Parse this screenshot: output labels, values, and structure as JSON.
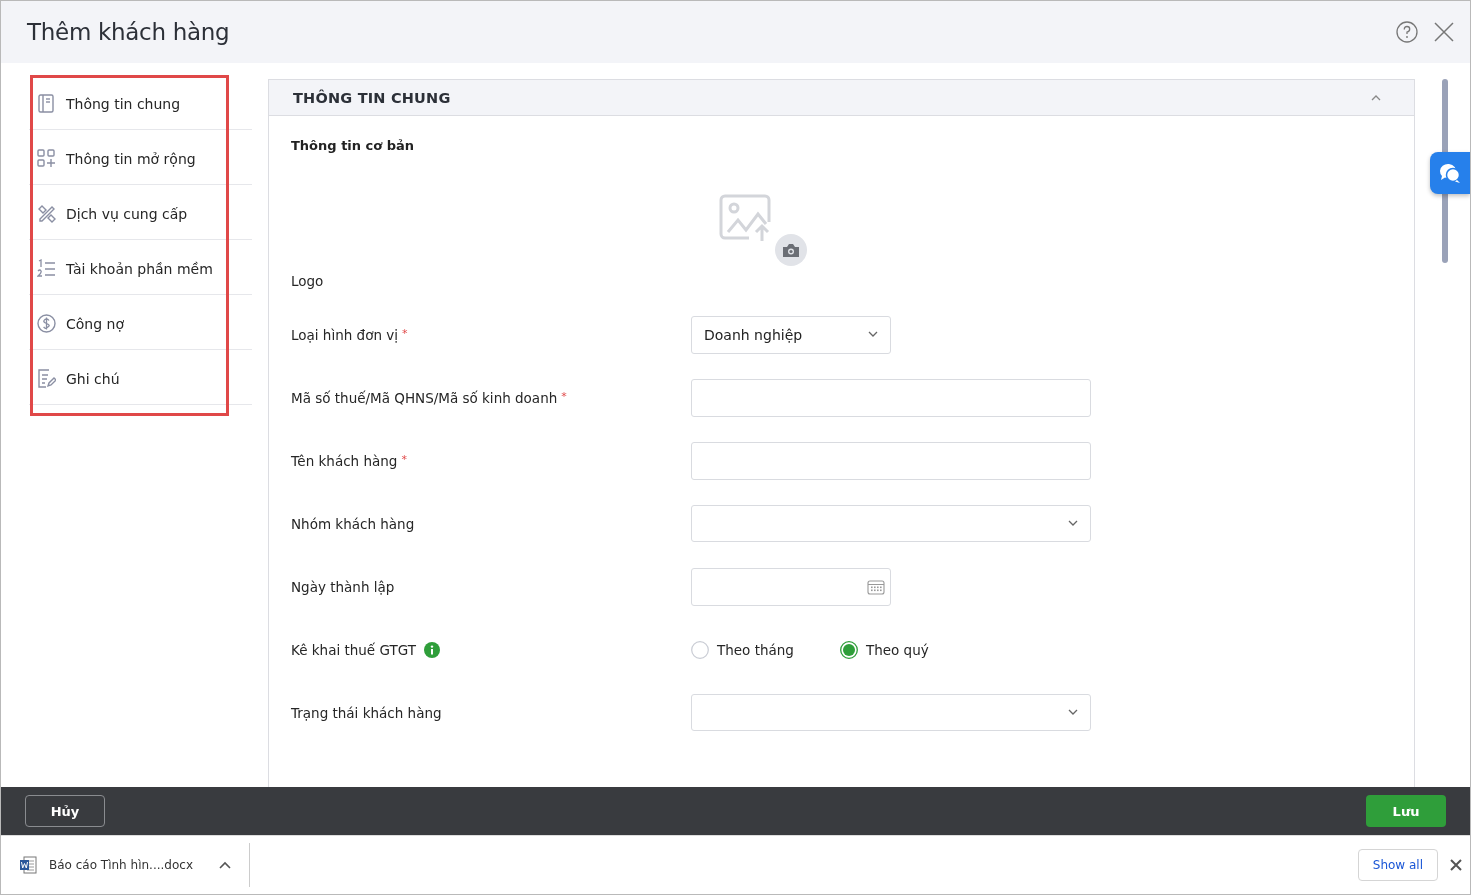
{
  "dialog": {
    "title": "Thêm khách hàng"
  },
  "nav": [
    {
      "label": "Thông tin chung"
    },
    {
      "label": "Thông tin mở rộng"
    },
    {
      "label": "Dịch vụ cung cấp"
    },
    {
      "label": "Tài khoản phần mềm"
    },
    {
      "label": "Công nợ"
    },
    {
      "label": "Ghi chú"
    }
  ],
  "section": {
    "title": "THÔNG TIN CHUNG",
    "expanded": true,
    "subtitle": "Thông tin cơ bản"
  },
  "fields": [
    {
      "kind": "logo",
      "label": "Logo"
    },
    {
      "kind": "dropdown",
      "label": "Loại hình đơn vị",
      "required_mark": "*",
      "value": "Doanh nghiệp"
    },
    {
      "kind": "text",
      "label": "Mã số thuế/Mã QHNS/Mã số kinh doanh",
      "required_mark": "*"
    },
    {
      "kind": "text",
      "label": "Tên khách hàng",
      "required_mark": "*"
    },
    {
      "kind": "combo",
      "label": "Nhóm khách hàng"
    },
    {
      "kind": "date",
      "label": "Ngày thành lập"
    },
    {
      "kind": "radio",
      "label": "Kê khai thuế GTGT",
      "info": true,
      "options": [
        {
          "label": "Theo tháng",
          "selected": false
        },
        {
          "label": "Theo quý",
          "selected": true
        }
      ]
    },
    {
      "kind": "combo",
      "label": "Trạng thái khách hàng"
    }
  ],
  "footer": {
    "cancel": "Hủy",
    "save": "Lưu"
  },
  "downloads": {
    "file": "Báo cáo Tình hìn....docx",
    "show_all": "Show all"
  }
}
